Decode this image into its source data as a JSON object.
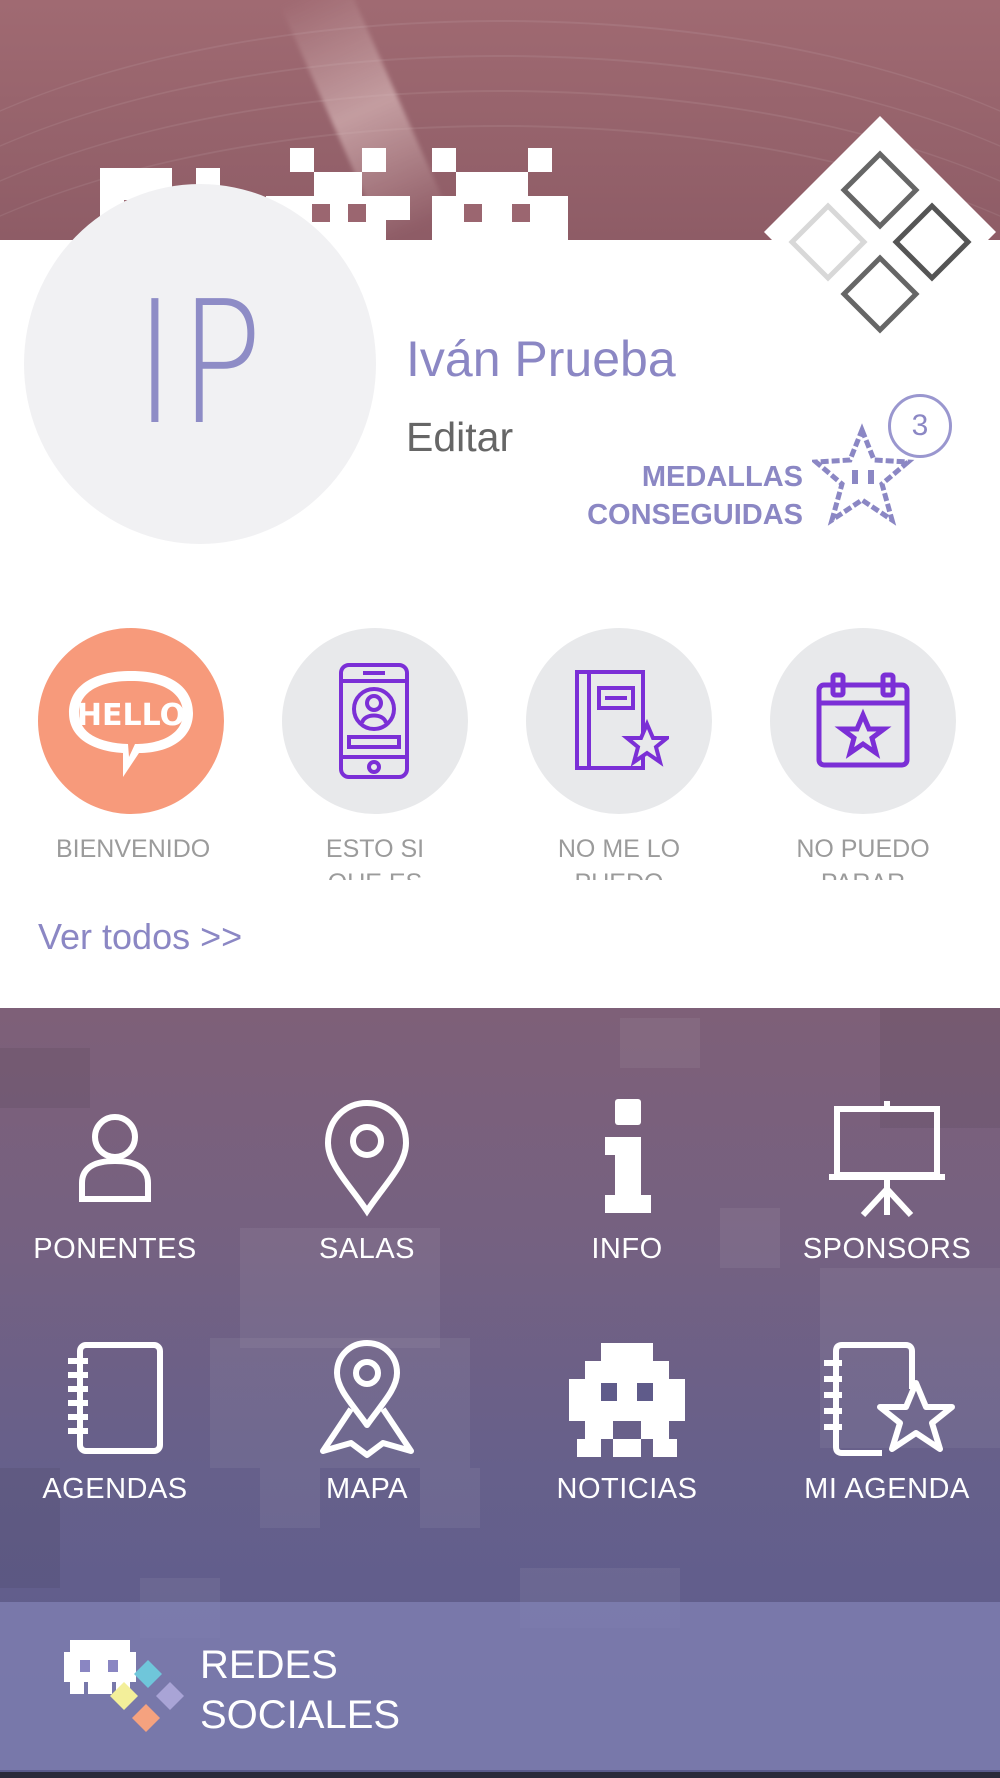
{
  "profile": {
    "initials": "IP",
    "name": "Iván Prueba",
    "edit_label": "Editar",
    "medals_label_line1": "MEDALLAS",
    "medals_label_line2": "CONSEGUIDAS",
    "medal_count": "3"
  },
  "medals": [
    {
      "label": "BIENVENIDO",
      "icon": "hello-bubble-icon"
    },
    {
      "label": "ESTO SI QUE ES",
      "icon": "phone-profile-icon"
    },
    {
      "label": "NO ME LO PUEDO",
      "icon": "notebook-star-icon"
    },
    {
      "label": "NO PUEDO PARAR",
      "icon": "calendar-star-icon"
    }
  ],
  "see_all_label": "Ver todos >>",
  "menu": [
    {
      "label": "PONENTES",
      "icon": "person-icon"
    },
    {
      "label": "SALAS",
      "icon": "location-pin-icon"
    },
    {
      "label": "INFO",
      "icon": "info-icon"
    },
    {
      "label": "SPONSORS",
      "icon": "presentation-board-icon"
    },
    {
      "label": "AGENDAS",
      "icon": "notebook-icon"
    },
    {
      "label": "MAPA",
      "icon": "map-pin-icon"
    },
    {
      "label": "NOTICIAS",
      "icon": "space-invader-icon"
    },
    {
      "label": "MI AGENDA",
      "icon": "notebook-star-icon"
    }
  ],
  "social": {
    "line1": "REDES",
    "line2": "SOCIALES",
    "icon": "invader-diamonds-icon"
  },
  "colors": {
    "accent": "#8b87c4",
    "hello_orange": "#f79a7b",
    "icon_purple": "#7b2fd6",
    "header": "#9b6670"
  }
}
